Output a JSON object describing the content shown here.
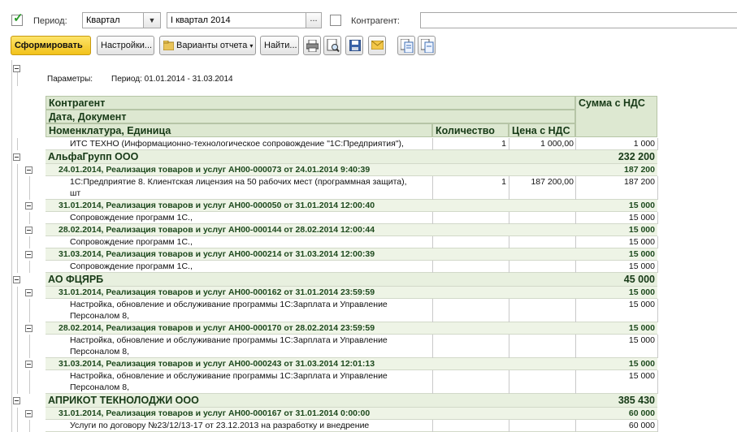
{
  "filter": {
    "period_checked": true,
    "period_label": "Период:",
    "period_type": "Квартал",
    "period_value": "I квартал 2014",
    "ellipsis": "...",
    "counterparty_checked": false,
    "counterparty_label": "Контрагент:",
    "counterparty_value": ""
  },
  "toolbar": {
    "generate": "Сформировать",
    "settings": "Настройки...",
    "variants": "Варианты отчета",
    "find": "Найти..."
  },
  "report": {
    "params_label": "Параметры:",
    "params_value": "Период: 01.01.2014 - 31.03.2014",
    "headers": {
      "counterparty": "Контрагент",
      "date_doc": "Дата, Документ",
      "item": "Номенклатура, Единица",
      "qty": "Количество",
      "price": "Цена с НДС",
      "sum": "Сумма с НДС"
    },
    "rows": [
      {
        "kind": "det",
        "text": "ИТС ТЕХНО  (Информационно-технологическое сопровождение \"1С:Предприятия\"),",
        "qty": "1",
        "price": "1 000,00",
        "sum": "1 000"
      },
      {
        "kind": "grp1",
        "text": "АльфаГрупп ООО",
        "sum": "232 200"
      },
      {
        "kind": "grp2",
        "text": "24.01.2014, Реализация товаров и услуг АН00-000073 от 24.01.2014 9:40:39",
        "sum": "187 200"
      },
      {
        "kind": "det2",
        "text": "1С:Предприятие 8. Клиентская лицензия на 50 рабочих мест (программная защита),",
        "text2": "шт",
        "qty": "1",
        "price": "187 200,00",
        "sum": "187 200"
      },
      {
        "kind": "grp2",
        "text": "31.01.2014, Реализация товаров и услуг АН00-000050 от 31.01.2014 12:00:40",
        "sum": "15 000"
      },
      {
        "kind": "det",
        "text": "Сопровождение программ 1С.,",
        "sum": "15 000"
      },
      {
        "kind": "grp2",
        "text": "28.02.2014, Реализация товаров и услуг АН00-000144 от 28.02.2014 12:00:44",
        "sum": "15 000"
      },
      {
        "kind": "det",
        "text": "Сопровождение программ 1С.,",
        "sum": "15 000"
      },
      {
        "kind": "grp2",
        "text": "31.03.2014, Реализация товаров и услуг АН00-000214 от 31.03.2014 12:00:39",
        "sum": "15 000"
      },
      {
        "kind": "det",
        "text": "Сопровождение программ 1С.,",
        "sum": "15 000"
      },
      {
        "kind": "grp1",
        "text": "АО ФЦЯРБ",
        "sum": "45 000"
      },
      {
        "kind": "grp2",
        "text": "31.01.2014, Реализация товаров и услуг АН00-000162 от 31.01.2014 23:59:59",
        "sum": "15 000"
      },
      {
        "kind": "det2",
        "text": "Настройка, обновление и обслуживание программы 1С:Зарплата и Управление",
        "text2": "Персоналом 8,",
        "sum": "15 000"
      },
      {
        "kind": "grp2",
        "text": "28.02.2014, Реализация товаров и услуг АН00-000170 от 28.02.2014 23:59:59",
        "sum": "15 000"
      },
      {
        "kind": "det2",
        "text": "Настройка, обновление и обслуживание программы 1С:Зарплата и Управление",
        "text2": "Персоналом 8,",
        "sum": "15 000"
      },
      {
        "kind": "grp2",
        "text": "31.03.2014, Реализация товаров и услуг АН00-000243 от 31.03.2014 12:01:13",
        "sum": "15 000"
      },
      {
        "kind": "det2",
        "text": "Настройка, обновление и обслуживание программы 1С:Зарплата и Управление",
        "text2": "Персоналом 8,",
        "sum": "15 000"
      },
      {
        "kind": "grp1",
        "text": "АПРИКОТ ТЕКНОЛОДЖИ ООО",
        "sum": "385 430"
      },
      {
        "kind": "grp2",
        "text": "31.01.2014, Реализация товаров и услуг АН00-000167 от 31.01.2014 0:00:00",
        "sum": "60 000"
      },
      {
        "kind": "det",
        "text": "Услуги по договору №23/12/13-17 от 23.12.2013 на разработку и внедрение",
        "sum": "60 000"
      }
    ]
  }
}
